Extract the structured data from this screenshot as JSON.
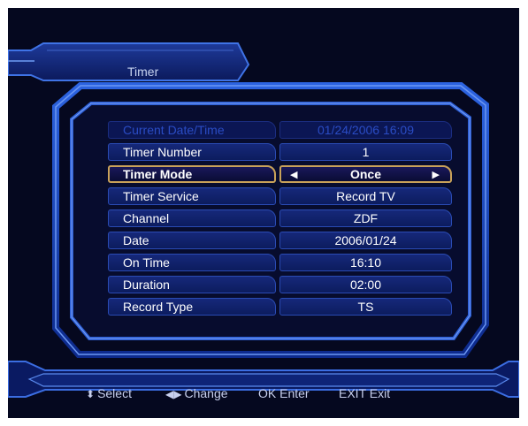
{
  "window": {
    "title": "Timer"
  },
  "rows": [
    {
      "label": "Current Date/Time",
      "value": "01/24/2006 16:09"
    },
    {
      "label": "Timer Number",
      "value": "1"
    },
    {
      "label": "Timer Mode",
      "value": "Once"
    },
    {
      "label": "Timer Service",
      "value": "Record TV"
    },
    {
      "label": "Channel",
      "value": "ZDF"
    },
    {
      "label": "Date",
      "value": "2006/01/24"
    },
    {
      "label": "On Time",
      "value": "16:10"
    },
    {
      "label": "Duration",
      "value": "02:00"
    },
    {
      "label": "Record Type",
      "value": "TS"
    }
  ],
  "selector": {
    "left_arrow": "◀",
    "right_arrow": "▶"
  },
  "footer": {
    "select": {
      "icon": "⬍",
      "label": "Select"
    },
    "change": {
      "icon": "◀▶",
      "label": "Change"
    },
    "enter": {
      "key": "OK",
      "label": "Enter"
    },
    "exit": {
      "key": "EXIT",
      "label": "Exit"
    }
  },
  "colors": {
    "background": "#05081f",
    "frame": "#3a6fe0",
    "highlight": "#c9a259",
    "disabled_text": "#2a4cc4"
  }
}
